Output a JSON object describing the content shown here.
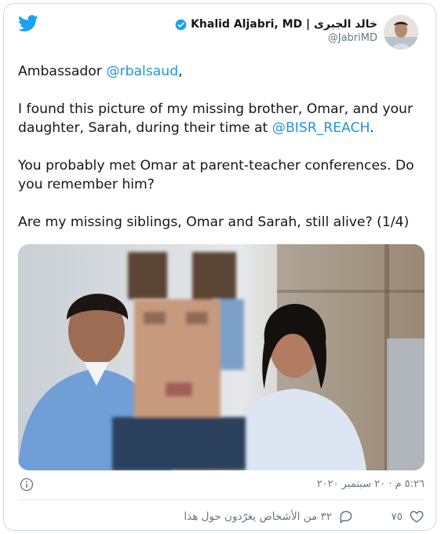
{
  "colors": {
    "brand": "#1da1f2",
    "link": "#1b95e0",
    "muted": "#657786",
    "border": "#cfd9de"
  },
  "icons": {
    "logo": "twitter-bird-icon",
    "verified": "verified-badge-icon",
    "info": "info-icon",
    "reply": "speech-bubble-icon",
    "like": "heart-icon"
  },
  "author": {
    "name": "Khalid Aljabri, MD | خالد الجبرى",
    "handle": "@JabriMD"
  },
  "tweet": {
    "p1_prefix": "Ambassador ",
    "p1_mention": "@rbalsaud",
    "p1_suffix": ",",
    "p2_text": "I found this picture of my missing brother, Omar, and your daughter, Sarah, during their time at ",
    "p2_mention": "@BISR_REACH",
    "p2_suffix": ".",
    "p3": "You probably met Omar at parent-teacher conferences. Do you remember him?",
    "p4": "Are my missing siblings, Omar and Sarah, still alive? (1/4)"
  },
  "timestamp": "٥:٢٦ م · ٢٠ سبتمبر ٢٠٢٠",
  "actions": {
    "reply_label": "٣٢ من الأشخاص يغرّدون حول هذا",
    "like_count": "٧٥"
  }
}
